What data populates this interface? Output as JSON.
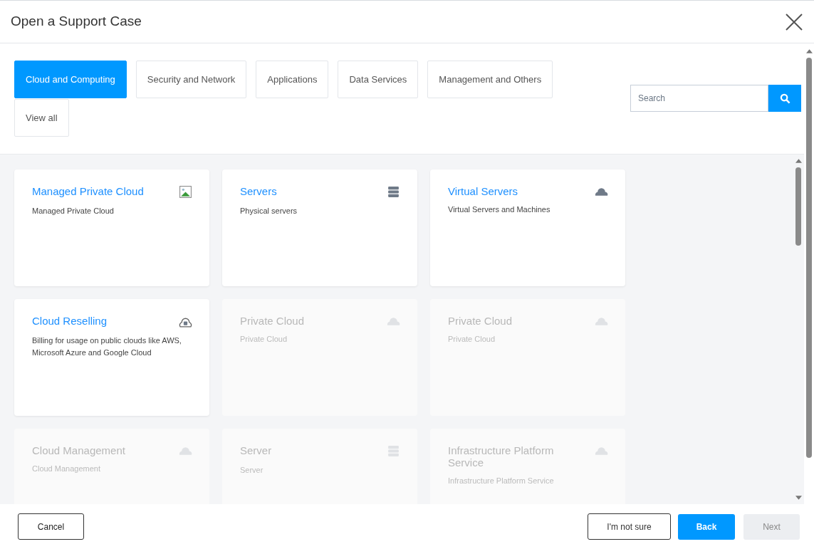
{
  "window": {
    "title": "Open a Support Case"
  },
  "categories": [
    {
      "label": "Cloud and Computing",
      "selected": true
    },
    {
      "label": "Security and Network",
      "selected": false
    },
    {
      "label": "Applications",
      "selected": false
    },
    {
      "label": "Data Services",
      "selected": false
    },
    {
      "label": "Management and Others",
      "selected": false
    },
    {
      "label": "View all",
      "selected": false
    }
  ],
  "search": {
    "placeholder": "Search"
  },
  "cards": [
    {
      "title": "Managed Private Cloud",
      "description": "Managed Private Cloud",
      "kind": "image",
      "disabled": false
    },
    {
      "title": "Servers",
      "description": "Physical servers",
      "kind": "server",
      "disabled": false
    },
    {
      "title": "Virtual Servers",
      "description": "Virtual Servers and Machines",
      "kind": "cloud",
      "disabled": false
    },
    {
      "title": "Cloud Reselling",
      "description": "Billing for usage on public clouds like AWS, Microsoft Azure and Google Cloud",
      "kind": "bag",
      "disabled": false
    },
    {
      "title": "Private Cloud",
      "description": "Private Cloud",
      "kind": "cloud",
      "disabled": true
    },
    {
      "title": "Private Cloud",
      "description": "Private Cloud",
      "kind": "cloud",
      "disabled": true
    },
    {
      "title": "Cloud Management",
      "description": "Cloud Management",
      "kind": "cloud",
      "disabled": true
    },
    {
      "title": "Server",
      "description": "Server",
      "kind": "server",
      "disabled": true
    },
    {
      "title": "Infrastructure Platform Service",
      "description": "Infrastructure Platform Service",
      "kind": "cloud",
      "disabled": true
    }
  ],
  "footer": {
    "cancel": "Cancel",
    "not_sure": "I'm not sure",
    "back": "Back",
    "next": {
      "label": "Next",
      "disabled": true
    }
  }
}
